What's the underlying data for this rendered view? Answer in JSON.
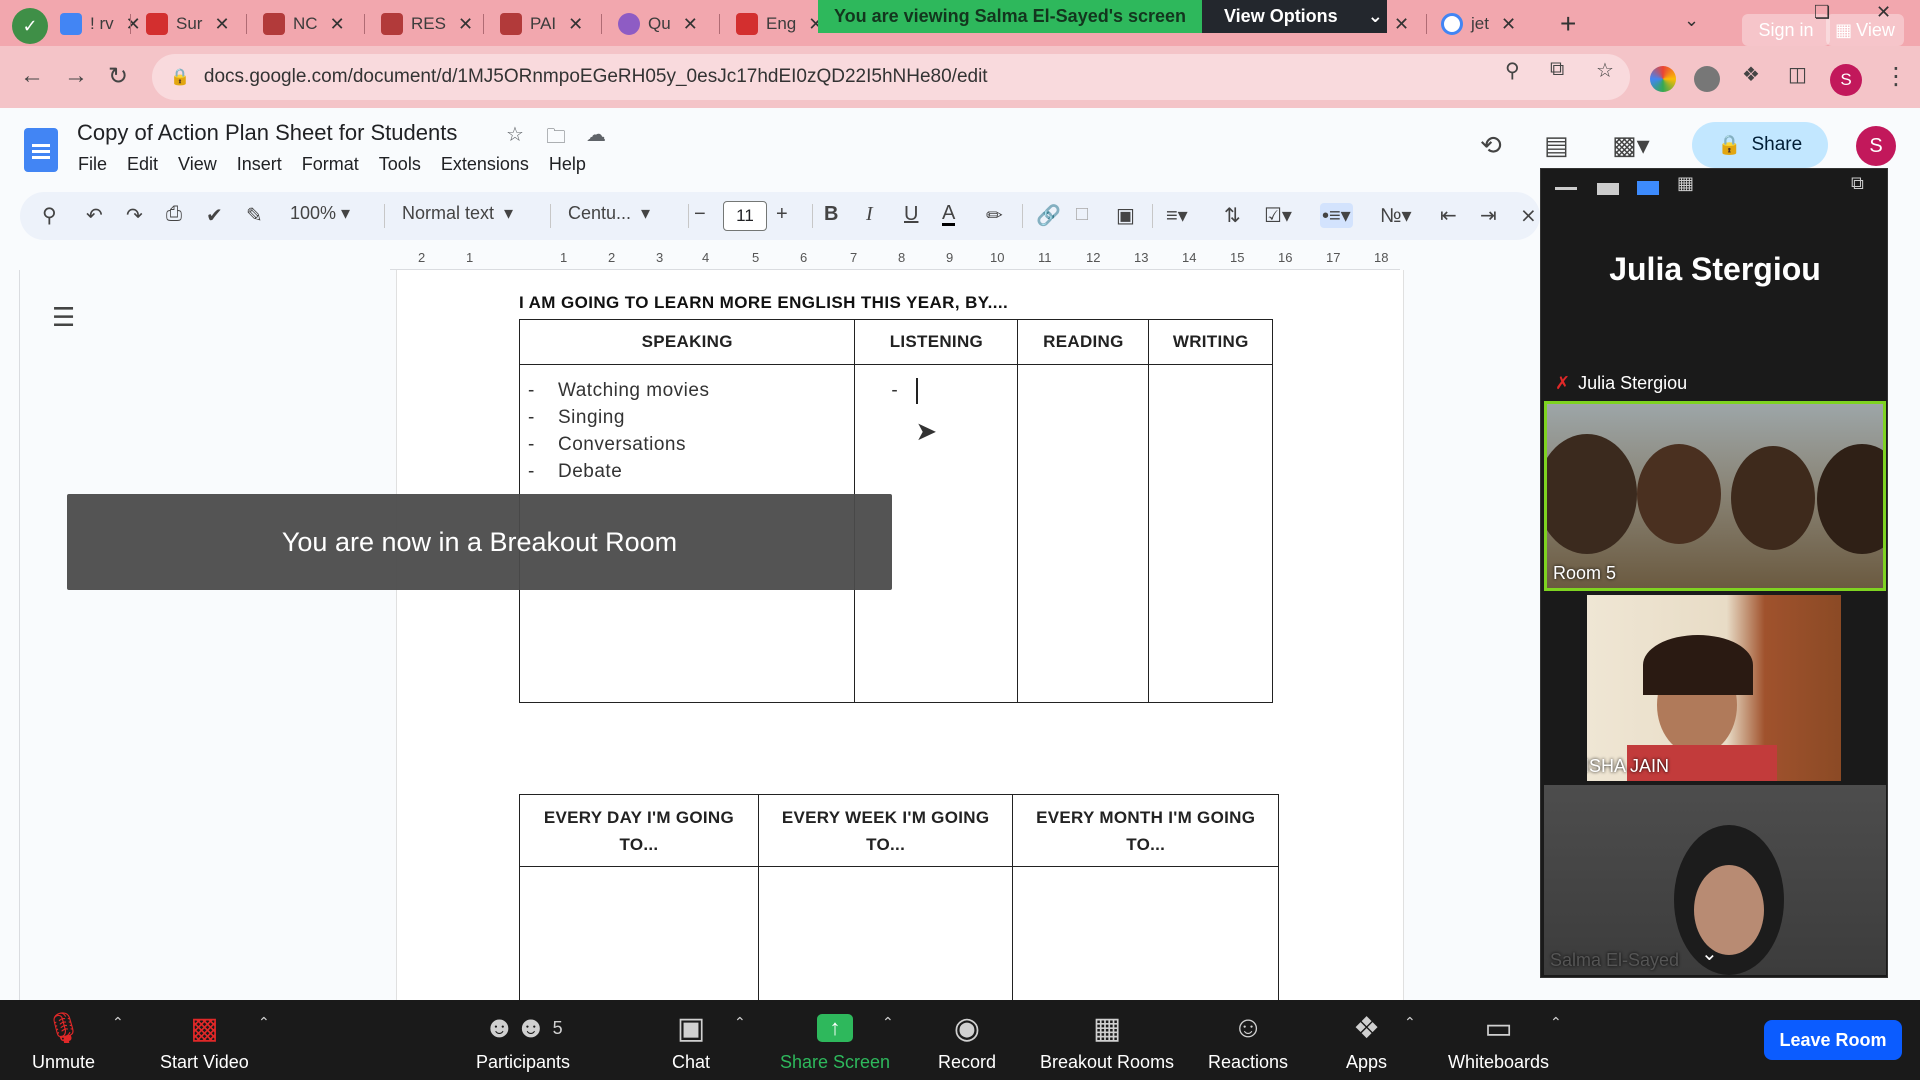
{
  "browser": {
    "tabs": [
      {
        "label": "! rv",
        "favicon_color": "#4285f4"
      },
      {
        "label": "Sur",
        "favicon_color": "#d32f2f"
      },
      {
        "label": "NC",
        "favicon_color": "#b23a3a"
      },
      {
        "label": "RES",
        "favicon_color": "#b23a3a"
      },
      {
        "label": "PAI",
        "favicon_color": "#b23a3a"
      },
      {
        "label": "Qu",
        "favicon_color": "#8e5cc4"
      },
      {
        "label": "Eng",
        "favicon_color": "#d32f2f"
      },
      {
        "label": "jet",
        "favicon_color": "#4285f4"
      }
    ],
    "tab_close_icon": "close-icon",
    "sign_in": "Sign in",
    "view": "View",
    "url": "docs.google.com/document/d/1MJ5ORnmpoEGeRH05y_0esJc17hdEI0zQD22I5hNHe80/edit"
  },
  "zoom_banner": {
    "viewing": "You are viewing Salma El-Sayed's screen",
    "view_options": "View Options"
  },
  "doc": {
    "title": "Copy of Action Plan Sheet for Students",
    "menu": [
      "File",
      "Edit",
      "View",
      "Insert",
      "Format",
      "Tools",
      "Extensions",
      "Help"
    ],
    "share": "Share",
    "avatar_letter": "S",
    "toolbar": {
      "zoom": "100%",
      "style": "Normal text",
      "font": "Centu...",
      "font_size": "11"
    },
    "ruler_ticks": [
      "2",
      "1",
      "1",
      "2",
      "3",
      "4",
      "5",
      "6",
      "7",
      "8",
      "9",
      "10",
      "11",
      "12",
      "13",
      "14",
      "15",
      "16",
      "17",
      "18"
    ],
    "heading": "I AM GOING TO LEARN MORE ENGLISH THIS YEAR, BY....",
    "skills_table": {
      "headers": [
        "SPEAKING",
        "LISTENING",
        "READING",
        "WRITING"
      ],
      "speaking_items": [
        "Watching movies",
        "Singing",
        "Conversations",
        "Debate"
      ],
      "listening_items": [
        "-"
      ]
    },
    "plans_table": {
      "headers": [
        "EVERY DAY I'M GOING TO...",
        "EVERY WEEK I'M GOING TO...",
        "EVERY MONTH I'M GOING TO..."
      ]
    }
  },
  "toast": "You are now in a Breakout Room",
  "gallery": {
    "active_speaker": "Julia Stergiou",
    "speaker_label": "Julia Stergiou",
    "tiles": [
      {
        "label": "Room 5"
      },
      {
        "label": "KENISHA JAIN"
      },
      {
        "label": "Salma El-Sayed"
      }
    ]
  },
  "zoom_controls": {
    "unmute": "Unmute",
    "start_video": "Start Video",
    "participants": "Participants",
    "participants_count": "5",
    "chat": "Chat",
    "share_screen": "Share Screen",
    "record": "Record",
    "breakout_rooms": "Breakout Rooms",
    "reactions": "Reactions",
    "apps": "Apps",
    "whiteboards": "Whiteboards",
    "leave_room": "Leave Room"
  },
  "colors": {
    "browser_tab_strip": "#f2a7ae",
    "zoom_green": "#2eb85c",
    "zoom_blue": "#0b5cff",
    "active_tile_border": "#7ed321"
  }
}
